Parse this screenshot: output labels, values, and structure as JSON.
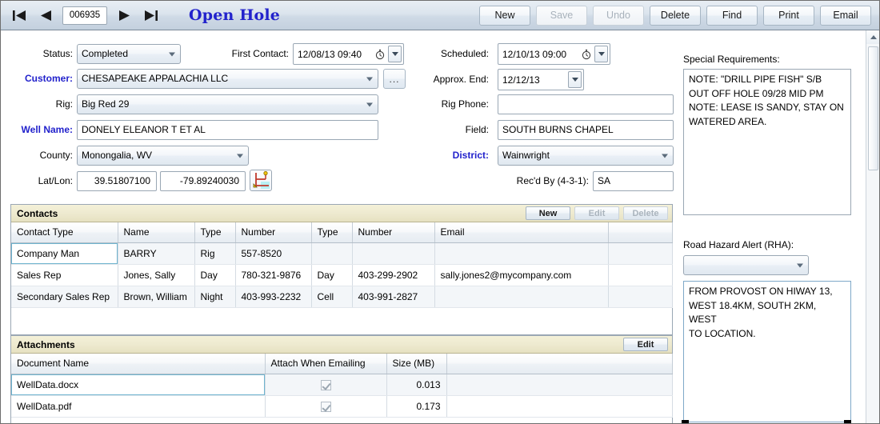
{
  "toolbar": {
    "record_number": "006935",
    "title": "Open Hole",
    "nav": {
      "first": "first-record",
      "prev": "previous-record",
      "next": "next-record",
      "last": "last-record"
    },
    "buttons": [
      {
        "label": "New",
        "disabled": false
      },
      {
        "label": "Save",
        "disabled": true
      },
      {
        "label": "Undo",
        "disabled": true
      },
      {
        "label": "Delete",
        "disabled": false
      },
      {
        "label": "Find",
        "disabled": false
      },
      {
        "label": "Print",
        "disabled": false
      },
      {
        "label": "Email",
        "disabled": false
      }
    ]
  },
  "form": {
    "status": {
      "label": "Status:",
      "value": "Completed"
    },
    "first_contact": {
      "label": "First Contact:",
      "value": "12/08/13 09:40"
    },
    "customer": {
      "label": "Customer:",
      "value": "CHESAPEAKE APPALACHIA LLC",
      "browse_label": "..."
    },
    "rig": {
      "label": "Rig:",
      "value": "Big Red 29"
    },
    "well_name": {
      "label": "Well Name:",
      "value": "DONELY ELEANOR T ET AL"
    },
    "county": {
      "label": "County:",
      "value": "Monongalia, WV"
    },
    "lat_lon": {
      "label": "Lat/Lon:",
      "lat": "39.51807100",
      "lon": "-79.89240030"
    },
    "scheduled": {
      "label": "Scheduled:",
      "value": "12/10/13 09:00"
    },
    "approx_end": {
      "label": "Approx. End:",
      "value": "12/12/13"
    },
    "rig_phone": {
      "label": "Rig Phone:",
      "value": ""
    },
    "field": {
      "label": "Field:",
      "value": "SOUTH BURNS CHAPEL"
    },
    "district": {
      "label": "District:",
      "value": "Wainwright"
    },
    "recd_by": {
      "label": "Rec'd By (4-3-1):",
      "value": "SA"
    }
  },
  "contacts": {
    "title": "Contacts",
    "buttons": [
      {
        "label": "New",
        "disabled": false
      },
      {
        "label": "Edit",
        "disabled": true
      },
      {
        "label": "Delete",
        "disabled": true
      }
    ],
    "columns": [
      "Contact Type",
      "Name",
      "Type",
      "Number",
      "Type",
      "Number",
      "Email",
      ""
    ],
    "rows": [
      {
        "contact_type": "Company Man",
        "name": "BARRY",
        "type1": "Rig",
        "number1": "557-8520",
        "type2": "",
        "number2": "",
        "email": "",
        "selected": true
      },
      {
        "contact_type": "Sales Rep",
        "name": "Jones, Sally",
        "type1": "Day",
        "number1": "780-321-9876",
        "type2": "Day",
        "number2": "403-299-2902",
        "email": "sally.jones2@mycompany.com",
        "selected": false
      },
      {
        "contact_type": "Secondary Sales Rep",
        "name": "Brown, William",
        "type1": "Night",
        "number1": "403-993-2232",
        "type2": "Cell",
        "number2": "403-991-2827",
        "email": "",
        "selected": false
      }
    ]
  },
  "attachments": {
    "title": "Attachments",
    "buttons": [
      {
        "label": "Edit",
        "disabled": false
      }
    ],
    "columns": [
      "Document Name",
      "Attach When Emailing",
      "Size (MB)",
      ""
    ],
    "rows": [
      {
        "document_name": "WellData.docx",
        "attach_when_emailing": true,
        "size_mb": "0.013",
        "selected": true
      },
      {
        "document_name": "WellData.pdf",
        "attach_when_emailing": true,
        "size_mb": "0.173",
        "selected": false
      }
    ]
  },
  "right_panel": {
    "special_requirements": {
      "label": "Special Requirements:",
      "value": "NOTE: \"DRILL PIPE FISH\" S/B\nOUT OFF HOLE 09/28 MID PM\nNOTE: LEASE IS SANDY, STAY ON\nWATERED AREA."
    },
    "road_hazard_alert": {
      "label": "Road Hazard Alert (RHA):",
      "selected": "",
      "value": "FROM PROVOST ON HIWAY 13,\nWEST 18.4KM, SOUTH 2KM, WEST\nTO LOCATION."
    }
  },
  "colors": {
    "title_blue": "#2222cc",
    "required_label_blue": "#2222cc",
    "panel_header_cream": "#eeead0",
    "selection_border": "#6fb4cf",
    "toolbar_gradient_top": "#e8eef4",
    "toolbar_gradient_bottom": "#c3d0de"
  }
}
